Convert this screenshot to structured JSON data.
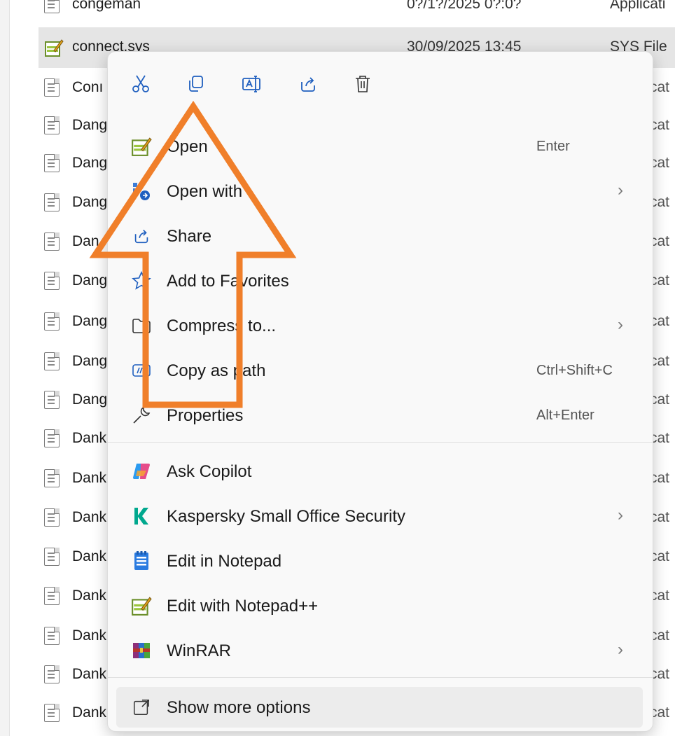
{
  "file_rows": [
    {
      "name": "congeman",
      "date": "0?/1?/2025 0?:0?",
      "type": "Applicati",
      "selected": false
    },
    {
      "name": "connect.sys",
      "date": "30/09/2025 13:45",
      "type": "SYS File",
      "selected": true
    },
    {
      "name": "Conı",
      "type_tail": "cat"
    },
    {
      "name": "Dang",
      "type_tail": "cat"
    },
    {
      "name": "Dang",
      "type_tail": "cat"
    },
    {
      "name": "Dang",
      "type_tail": "cat"
    },
    {
      "name": "Dan",
      "type_tail": "cat"
    },
    {
      "name": "Dang",
      "type_tail": "cat"
    },
    {
      "name": "Dang",
      "type_tail": "cat"
    },
    {
      "name": "Dang",
      "type_tail": "cat"
    },
    {
      "name": "Dang",
      "type_tail": "cat"
    },
    {
      "name": "Dank",
      "type_tail": "cat"
    },
    {
      "name": "Dank",
      "type_tail": "cat"
    },
    {
      "name": "Dank",
      "type_tail": "cat"
    },
    {
      "name": "Dank",
      "type_tail": "cat"
    },
    {
      "name": "Dank",
      "type_tail": "cat"
    },
    {
      "name": "Dank",
      "type_tail": "cat"
    },
    {
      "name": "Dank",
      "type_tail": "cat"
    }
  ],
  "quick_actions": [
    {
      "name": "cut-icon"
    },
    {
      "name": "copy-icon"
    },
    {
      "name": "rename-icon"
    },
    {
      "name": "share-icon"
    },
    {
      "name": "delete-icon"
    }
  ],
  "menu": {
    "open": {
      "label": "Open",
      "shortcut": "Enter"
    },
    "open_with": {
      "label": "Open with",
      "chevron": "›"
    },
    "share": {
      "label": "Share"
    },
    "favorites": {
      "label": "Add to Favorites"
    },
    "compress": {
      "label": "Compress to...",
      "chevron": "›"
    },
    "copy_path": {
      "label": "Copy as path",
      "shortcut": "Ctrl+Shift+C"
    },
    "properties": {
      "label": "Properties",
      "shortcut": "Alt+Enter"
    },
    "copilot": {
      "label": "Ask Copilot"
    },
    "kaspersky": {
      "label": "Kaspersky Small Office Security",
      "chevron": "›"
    },
    "notepad": {
      "label": "Edit in Notepad"
    },
    "notepadpp": {
      "label": "Edit with Notepad++"
    },
    "winrar": {
      "label": "WinRAR",
      "chevron": "›"
    },
    "more": {
      "label": "Show more options"
    }
  },
  "colors": {
    "arrow": "#f07f2a",
    "selected_row": "#e5e5e5",
    "menu_bg": "#f9f9f9",
    "icon_blue": "#1f5fbf",
    "kaspersky_green": "#00a88e"
  }
}
